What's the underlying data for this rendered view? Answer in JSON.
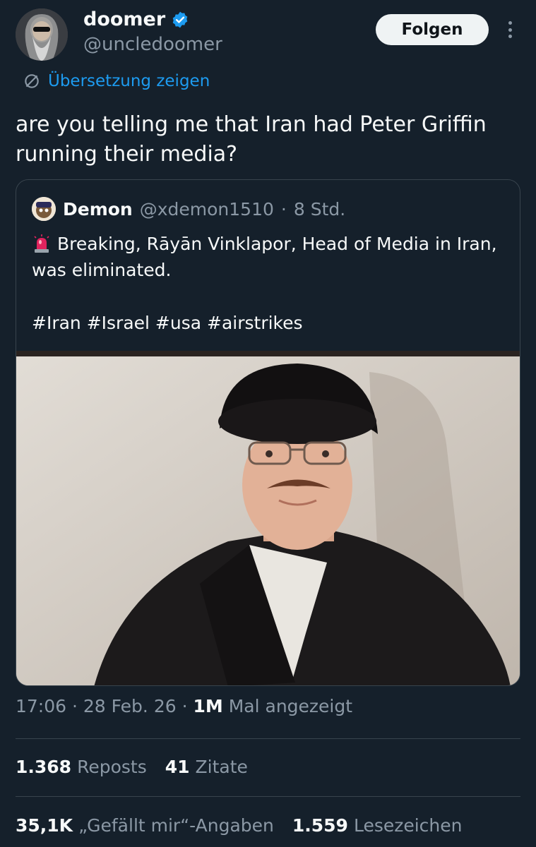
{
  "author": {
    "display_name": "doomer",
    "handle": "@uncledoomer",
    "verified_icon": "verified-badge-icon",
    "avatar": "avatar"
  },
  "follow_label": "Folgen",
  "more_icon": "more-options-icon",
  "translate": {
    "label": "Übersetzung zeigen",
    "icon": "translate-icon"
  },
  "tweet_text": "are you telling me that Iran had Peter Griffin running their media?",
  "quote": {
    "name": "Demon",
    "handle": "@xdemon1510",
    "separator": "·",
    "time": "8 Std.",
    "text": "Breaking, Rāyān Vinklapor, Head of Media in Iran, was eliminated.",
    "text_icon": "siren-icon",
    "hashtags": "#Iran #Israel #usa #airstrikes",
    "image": "photo of man in black turban and robe"
  },
  "meta": {
    "time": "17:06",
    "date": "28 Feb. 26",
    "views_count": "1M",
    "views_label": "Mal angezeigt",
    "sep": "·"
  },
  "stats": {
    "reposts_count": "1.368",
    "reposts_label": "Reposts",
    "quotes_count": "41",
    "quotes_label": "Zitate",
    "likes_count": "35,1K",
    "likes_label": "„Gefällt mir“-Angaben",
    "bookmarks_count": "1.559",
    "bookmarks_label": "Lesezeichen"
  },
  "colors": {
    "background": "#15202b",
    "text": "#f7f9f9",
    "secondary": "#8b98a5",
    "accent": "#1d9bf0",
    "border": "#38444d"
  }
}
